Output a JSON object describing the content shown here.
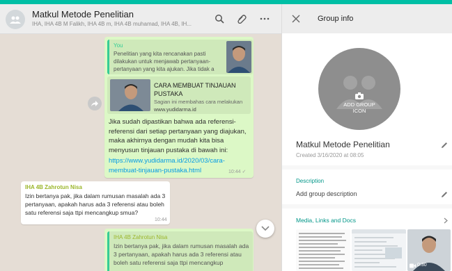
{
  "chat": {
    "title": "Matkul Metode Penelitian",
    "subtitle": "IHA, IHA 4B M Falikh, IHA 4B m, IHA 4B muhamad, IHA 4B, IH..."
  },
  "messages": {
    "out1": {
      "quote_author": "You",
      "quote_text": "Penelitian yang kita rencanakan pasti dilakukan untuk menjawab pertanyaan-pertanyaan yang kita ajukan. Jika tidak a",
      "link_title": "CARA MEMBUAT TINJAUAN PUSTAKA",
      "link_desc": "Sagian ini membahas cara melakukan",
      "link_domain": "www.yudidarma.id",
      "text": "Jika sudah dipastikan bahwa ada referensi-referensi dari setiap pertanyaan yang diajukan, maka akhirnya dengan mudah kita bisa menyusun tinjauan pustaka di bawah ini:",
      "url": "https://www.yudidarma.id/2020/03/cara-membuat-tinjauan-pustaka.html",
      "time": "10:44 ✓"
    },
    "in1": {
      "sender": "IHA 4B Zahrotun Nisa",
      "text": "Izin bertanya pak,  jika dalam rumusan masalah ada 3 pertanyaan, apakah harus ada 3 referensi atau boleh satu referensi saja ttpi mencangkup smua?",
      "time": "10:44"
    },
    "out2": {
      "quote_author": "IHA 4B Zahrotun Nisa",
      "quote_text": "Izin bertanya pak,  jika dalam rumusan masalah ada 3 pertanyaan, apakah harus ada 3 referensi atau boleh satu referensi saja ttpi mencangkup"
    }
  },
  "info": {
    "header_title": "Group info",
    "add_icon_label": "ADD GROUP ICON",
    "group_name": "Matkul Metode Penelitian",
    "created": "Created 3/16/2020 at 08:05",
    "description_label": "Description",
    "description_value": "Add group description",
    "media_label": "Media, Links and Docs",
    "video_duration": "0:30"
  },
  "colors": {
    "accent": "#00bfa5",
    "out_bubble": "#dcf8c6",
    "sender_name": "#9bb62b",
    "link": "#039be5"
  }
}
